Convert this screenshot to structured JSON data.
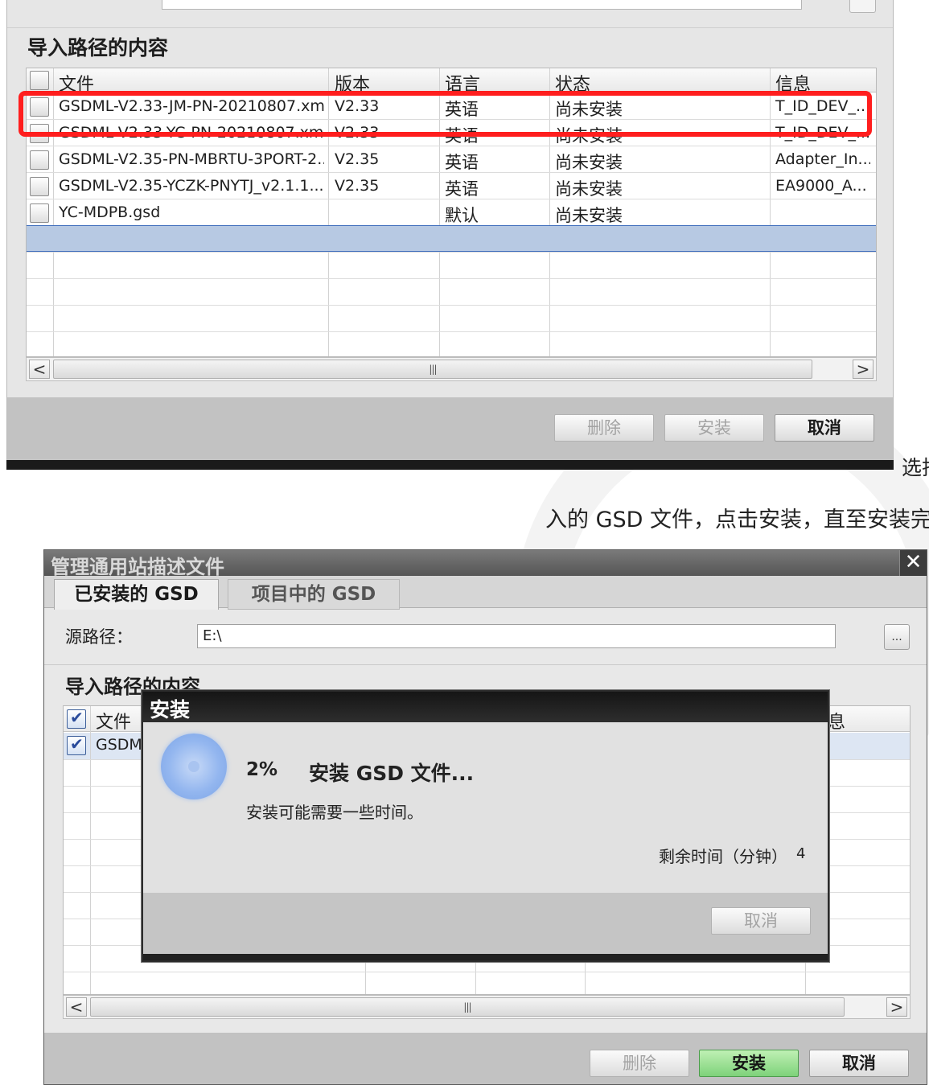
{
  "top_panel": {
    "section_title": "导入路径的内容",
    "columns": [
      "文件",
      "版本",
      "语言",
      "状态",
      "信息"
    ],
    "rows": [
      {
        "file": "GSDML-V2.33-JM-PN-20210807.xml",
        "version": "V2.33",
        "language": "英语",
        "status": "尚未安装",
        "info": "T_ID_DEV_..."
      },
      {
        "file": "GSDML-V2.33-YC-PN-20210807.xml",
        "version": "V2.33",
        "language": "英语",
        "status": "尚未安装",
        "info": "T_ID_DEV_..."
      },
      {
        "file": "GSDML-V2.35-PN-MBRTU-3PORT-2...",
        "version": "V2.35",
        "language": "英语",
        "status": "尚未安装",
        "info": "Adapter_In..."
      },
      {
        "file": "GSDML-V2.35-YCZK-PNYTJ_v2.1.1...",
        "version": "V2.35",
        "language": "英语",
        "status": "尚未安装",
        "info": "EA9000_A..."
      },
      {
        "file": "YC-MDPB.gsd",
        "version": "",
        "language": "默认",
        "status": "尚未安装",
        "info": ""
      }
    ],
    "scroll_left": "<",
    "scroll_right": ">",
    "scroll_grip": "|||",
    "buttons": {
      "delete": "删除",
      "install": "安装",
      "cancel": "取消"
    }
  },
  "caption": {
    "line1_fragment": "选择",
    "line2": "入的 GSD 文件，点击安装，直至安装完成"
  },
  "bottom_dialog": {
    "title": "管理通用站描述文件",
    "close_glyph": "✕",
    "tabs": [
      "已安装的 GSD",
      "项目中的 GSD"
    ],
    "source_path_label": "源路径：",
    "source_path_value": "E:\\",
    "browse_label": "...",
    "section_title": "导入路径的内容",
    "col_file": "文件",
    "col_info_fragment": "息",
    "row_file_fragment": "GSDM",
    "scroll_left": "<",
    "scroll_right": ">",
    "scroll_grip": "|||",
    "buttons": {
      "delete": "删除",
      "install": "安装",
      "cancel": "取消"
    }
  },
  "install_modal": {
    "title": "安装",
    "percent": "2%",
    "task": "安装 GSD 文件...",
    "note": "安装可能需要一些时间。",
    "remaining_label": "剩余时间（分钟）",
    "remaining_value": "4",
    "cancel": "取消"
  },
  "colors": {
    "highlight_box": "#ff1e1e",
    "selected_row": "#b7c9e3",
    "install_button": "#7ed27a"
  }
}
